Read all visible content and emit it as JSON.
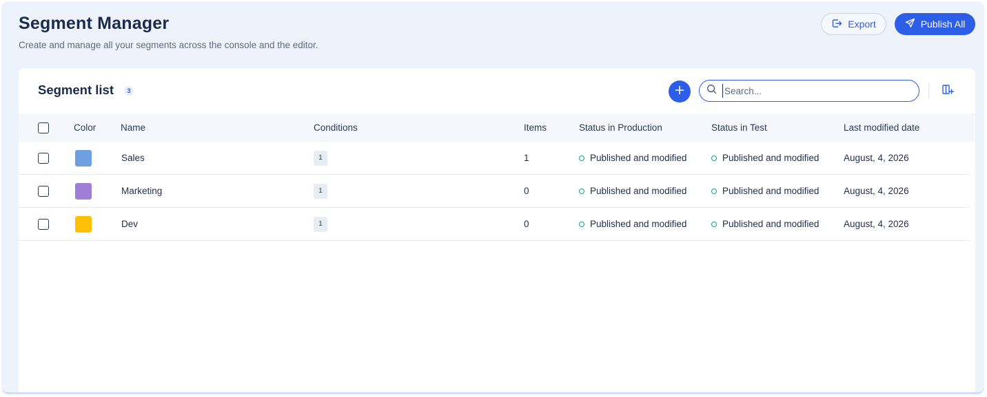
{
  "header": {
    "title": "Segment Manager",
    "subtitle": "Create and manage all your segments across the console and the editor.",
    "export_label": "Export",
    "publish_label": "Publish All"
  },
  "card": {
    "title": "Segment list",
    "count": "3",
    "search_placeholder": "Search..."
  },
  "table": {
    "columns": [
      "Color",
      "Name",
      "Conditions",
      "Items",
      "Status in Production",
      "Status in Test",
      "Last modified date"
    ],
    "rows": [
      {
        "color": "#6f9fe3",
        "name": "Sales",
        "conditions": "1",
        "items": "1",
        "status_production": "Published and modified",
        "status_test": "Published and modified",
        "last_modified": "August, 4, 2026"
      },
      {
        "color": "#a07ed8",
        "name": "Marketing",
        "conditions": "1",
        "items": "0",
        "status_production": "Published and modified",
        "status_test": "Published and modified",
        "last_modified": "August, 4, 2026"
      },
      {
        "color": "#ffc107",
        "name": "Dev",
        "conditions": "1",
        "items": "0",
        "status_production": "Published and modified",
        "status_test": "Published and modified",
        "last_modified": "August, 4, 2026"
      }
    ]
  },
  "colors": {
    "accent": "#2d5ee8",
    "status_dot": "#1aa37a",
    "background": "#eef2fa"
  },
  "icons": {
    "export": "export-icon",
    "publish": "send-icon",
    "add": "plus-icon",
    "search": "search-icon",
    "columns": "add-column-icon"
  }
}
